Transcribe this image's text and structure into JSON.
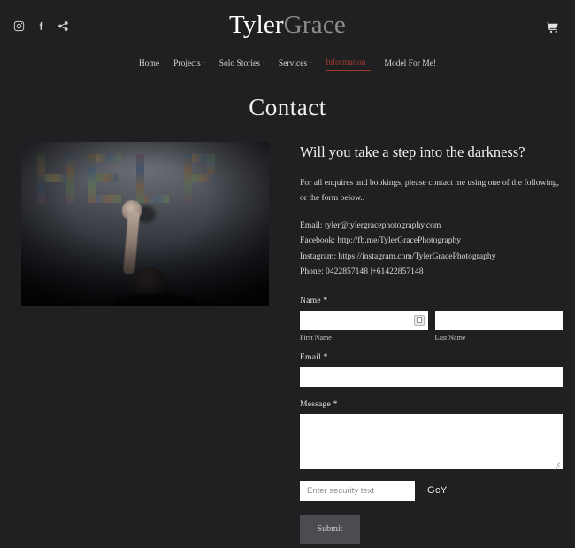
{
  "colors": {
    "background": "#1f2022",
    "accent_red": "#a6392c",
    "brand_white": "#ffffff",
    "brand_gray": "#8d8d8d",
    "submit_bg": "#4a4c4f"
  },
  "header": {
    "brand_first": "Tyler",
    "brand_second": "Grace",
    "social": [
      {
        "name": "instagram-icon",
        "label": "Instagram"
      },
      {
        "name": "facebook-icon",
        "label": "Facebook"
      },
      {
        "name": "share-icon",
        "label": "Share"
      }
    ],
    "cart_label": "Cart"
  },
  "nav": {
    "items": [
      {
        "label": "Home",
        "has_caret": false,
        "active": false
      },
      {
        "label": "Projects",
        "has_caret": true,
        "active": false
      },
      {
        "label": "Solo Stories",
        "has_caret": true,
        "active": false
      },
      {
        "label": "Services",
        "has_caret": true,
        "active": false
      },
      {
        "label": "Information",
        "has_caret": true,
        "active": true
      },
      {
        "label": "Model For Me!",
        "has_caret": false,
        "active": false
      }
    ],
    "caret_glyph": "ˇ"
  },
  "page": {
    "title": "Contact"
  },
  "photo": {
    "alt": "Dark photo of a person reaching up toward the word HELP spelled in photo-collage letters on a wall",
    "word": "HELP"
  },
  "main": {
    "headline": "Will you take a step into the darkness?",
    "intro": "For all enquires and bookings, please contact me using one of the following, or the form below..",
    "contacts": [
      "Email: tyler@tylergracephotography.com",
      "Facebook: http://fb.me/TylerGracePhotography",
      "Instagram: https://instagram.com/TylerGracePhotography",
      "Phone: 0422857148  |+61422857148"
    ]
  },
  "form": {
    "name": {
      "label": "Name *",
      "first_value": "",
      "first_placeholder": "",
      "first_sublabel": "First Name",
      "last_value": "",
      "last_placeholder": "",
      "last_sublabel": "Last Name"
    },
    "email": {
      "label": "Email *",
      "value": "",
      "placeholder": ""
    },
    "message": {
      "label": "Message *",
      "value": "",
      "placeholder": ""
    },
    "captcha": {
      "placeholder": "Enter security text",
      "value": "",
      "code": "GcY"
    },
    "submit_label": "Submit"
  }
}
